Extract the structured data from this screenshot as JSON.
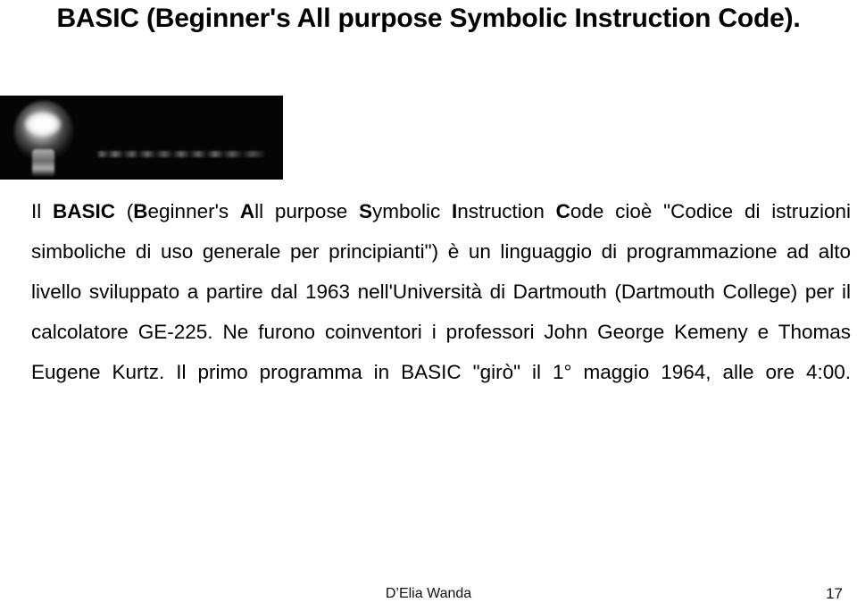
{
  "slide": {
    "title": "BASIC (Beginner's All purpose Symbolic Instruction Code).",
    "page_number": "17",
    "author": "D’Elia Wanda",
    "background_color": "#ffffff",
    "text_color": "#000000"
  },
  "picture": {
    "alt": "lightbulb-photo",
    "background_color": "#050505",
    "caption_text": ""
  },
  "body": {
    "segments": [
      {
        "text": "Il ",
        "bold": false
      },
      {
        "text": "B",
        "bold": true
      },
      {
        "text": "eginner's ",
        "bold": false
      },
      {
        "text": "A",
        "bold": true
      },
      {
        "text": "ll purpose ",
        "bold": false
      },
      {
        "text": "S",
        "bold": true
      },
      {
        "text": "ymbolic ",
        "bold": false
      },
      {
        "text": "I",
        "bold": true
      },
      {
        "text": "nstruction ",
        "bold": false
      },
      {
        "text": "C",
        "bold": true
      },
      {
        "text": "ode",
        "bold": false
      }
    ],
    "full_text": "Il BASIC (Beginner's All purpose Symbolic Instruction Code cioè \"Codice di istruzioni simboliche di uso generale per principianti\") è un linguaggio di programmazione ad alto livello sviluppato a partire dal 1963 nell'Università di Dartmouth (Dartmouth College) per il calcolatore GE-225. Ne furono coinventori i professori John George Kemeny e Thomas Eugene Kurtz. Il primo programma in BASIC \"girò\" il 1° maggio 1964, alle ore 4:00.",
    "parts": {
      "p1": "Il ",
      "b_basic": "BASIC",
      "p2": " (",
      "b_B": "B",
      "p3": "eginner's ",
      "b_A": "A",
      "p4": "ll purpose ",
      "b_S": "S",
      "p5": "ymbolic ",
      "b_I": "I",
      "p6": "nstruction ",
      "b_C": "C",
      "p7": "ode cioè \"Codice di istruzioni simboliche di uso generale per principianti\") è un linguaggio di programmazione ad alto livello sviluppato a partire dal 1963 nell'Università di Dartmouth (Dartmouth College) per il calcolatore GE-225. Ne furono coinventori i professori John George Kemeny e Thomas Eugene Kurtz. Il primo programma in BASIC \"girò\" il 1° maggio 1964, alle ore 4:00."
    }
  }
}
